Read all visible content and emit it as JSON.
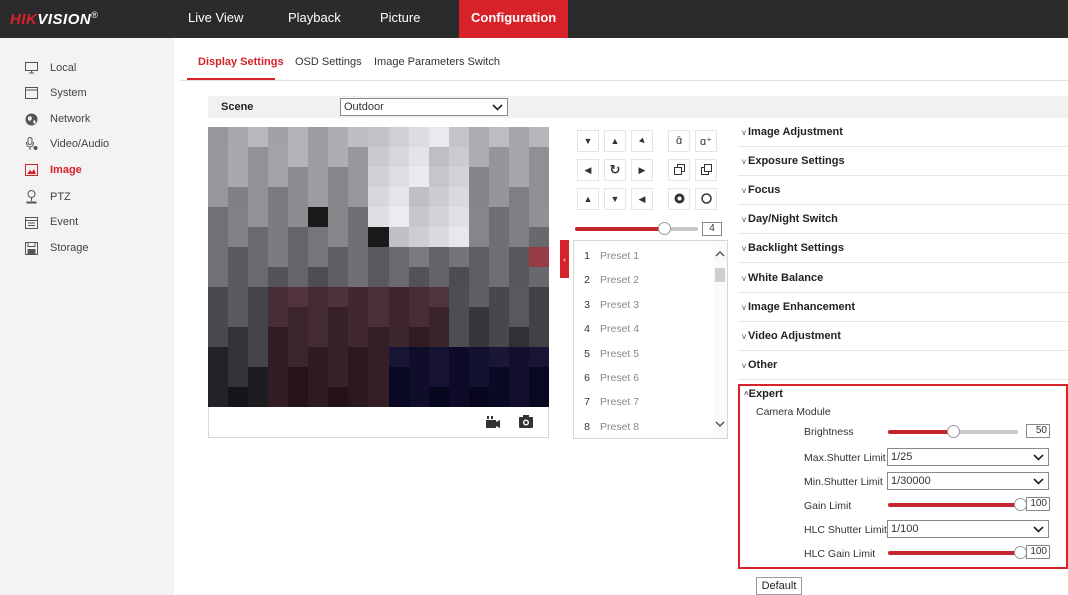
{
  "brand": {
    "name_red": "HIK",
    "name_white": "VISION",
    "mark": "®"
  },
  "nav": {
    "tabs": [
      "Live View",
      "Playback",
      "Picture",
      "Configuration"
    ]
  },
  "sidebar": {
    "items": [
      {
        "label": "Local",
        "icon": "monitor-icon"
      },
      {
        "label": "System",
        "icon": "system-icon"
      },
      {
        "label": "Network",
        "icon": "globe-icon"
      },
      {
        "label": "Video/Audio",
        "icon": "microphone-icon"
      },
      {
        "label": "Image",
        "icon": "image-icon"
      },
      {
        "label": "PTZ",
        "icon": "ptz-icon"
      },
      {
        "label": "Event",
        "icon": "calendar-icon"
      },
      {
        "label": "Storage",
        "icon": "disk-icon"
      }
    ],
    "active": "Image"
  },
  "subtabs": {
    "items": [
      "Display Settings",
      "OSD Settings",
      "Image Parameters Switch"
    ],
    "active": "Display Settings"
  },
  "scene": {
    "label": "Scene",
    "value": "Outdoor"
  },
  "ptz": {
    "zoom_value": "4",
    "zoom_level": 0.72
  },
  "presets": [
    {
      "num": "1",
      "name": "Preset 1"
    },
    {
      "num": "2",
      "name": "Preset 2"
    },
    {
      "num": "3",
      "name": "Preset 3"
    },
    {
      "num": "4",
      "name": "Preset 4"
    },
    {
      "num": "5",
      "name": "Preset 5"
    },
    {
      "num": "6",
      "name": "Preset 6"
    },
    {
      "num": "7",
      "name": "Preset 7"
    },
    {
      "num": "8",
      "name": "Preset 8"
    }
  ],
  "sections": [
    "Image Adjustment",
    "Exposure Settings",
    "Focus",
    "Day/Night Switch",
    "Backlight Settings",
    "White Balance",
    "Image Enhancement",
    "Video Adjustment",
    "Other"
  ],
  "expert": {
    "title": "Expert",
    "module_label": "Camera Module",
    "brightness": {
      "label": "Brightness",
      "value": "50",
      "level": 0.5
    },
    "max_shutter": {
      "label": "Max.Shutter Limit",
      "value": "1/25"
    },
    "min_shutter": {
      "label": "Min.Shutter Limit",
      "value": "1/30000"
    },
    "gain_limit": {
      "label": "Gain Limit",
      "value": "100",
      "level": 1.0
    },
    "hlc_shutter": {
      "label": "HLC Shutter Limit",
      "value": "1/100"
    },
    "hlc_gain": {
      "label": "HLC Gain Limit",
      "value": "100",
      "level": 1.0
    }
  },
  "default_button": "Default",
  "colors": {
    "accent": "#d8222a",
    "topbar": "#2b2b2b"
  }
}
